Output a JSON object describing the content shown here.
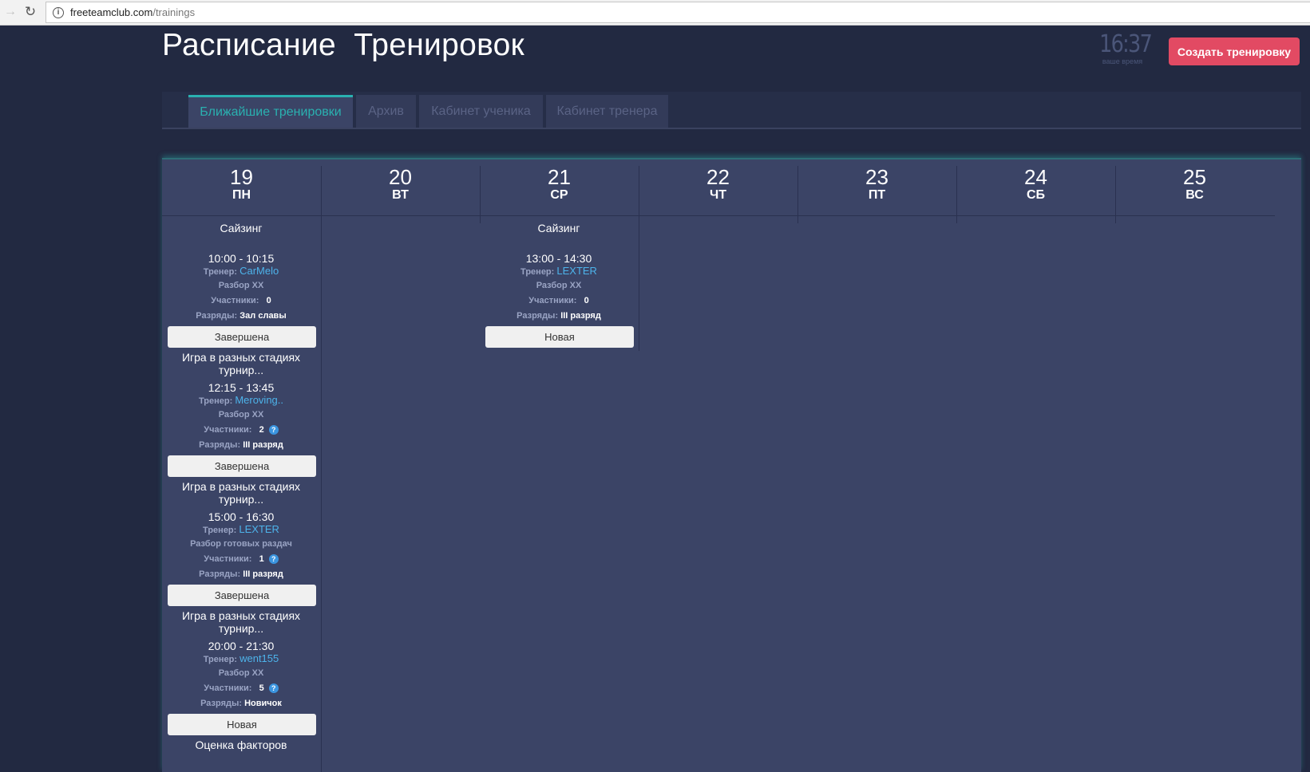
{
  "browser": {
    "url_domain": "freeteamclub.com",
    "url_path": "/trainings"
  },
  "header": {
    "title": "Расписание  Тренировок",
    "clock_time": "16:37",
    "clock_label": "ваше время",
    "create_button": "Создать тренировку"
  },
  "tabs": [
    {
      "label": "Ближайшие тренировки",
      "active": true
    },
    {
      "label": "Архив",
      "active": false
    },
    {
      "label": "Кабинет ученика",
      "active": false
    },
    {
      "label": "Кабинет тренера",
      "active": false
    }
  ],
  "labels": {
    "trainer": "Тренер:",
    "participants": "Участники:",
    "ranks": "Разряды:"
  },
  "days": [
    {
      "num": "19",
      "name": "ПН"
    },
    {
      "num": "20",
      "name": "ВТ"
    },
    {
      "num": "21",
      "name": "СР"
    },
    {
      "num": "22",
      "name": "ЧТ"
    },
    {
      "num": "23",
      "name": "ПТ"
    },
    {
      "num": "24",
      "name": "СБ"
    },
    {
      "num": "25",
      "name": "ВС"
    }
  ],
  "trainings": {
    "mon": [
      {
        "title": "Сайзинг",
        "time": "10:00 - 10:15",
        "trainer": "CarMelo",
        "topic": "Разбор XX",
        "participants": "0",
        "ranks": "Зал славы",
        "status": "Завершена"
      },
      {
        "title": "Игра в разных стадиях турнир...",
        "time": "12:15 - 13:45",
        "trainer": "Meroving..",
        "topic": "Разбор XX",
        "participants": "2",
        "ranks": "III разряд",
        "status": "Завершена"
      },
      {
        "title": "Игра в разных стадиях турнир...",
        "time": "15:00 - 16:30",
        "trainer": "LEXTER",
        "topic": "Разбор готовых раздач",
        "participants": "1",
        "ranks": "III разряд",
        "status": "Завершена"
      },
      {
        "title": "Игра в разных стадиях турнир...",
        "time": "20:00 - 21:30",
        "trainer": "went155",
        "topic": "Разбор XX",
        "participants": "5",
        "ranks": "Новичок",
        "status": "Новая"
      },
      {
        "title": "Оценка факторов"
      }
    ],
    "wed": [
      {
        "title": "Сайзинг",
        "time": "13:00 - 14:30",
        "trainer": "LEXTER",
        "topic": "Разбор XX",
        "participants": "0",
        "ranks": "III разряд",
        "status": "Новая"
      }
    ]
  },
  "colors": {
    "background": "#222941",
    "panel": "#3b4466",
    "accent": "#2ab1b0",
    "create_button": "#e24a63",
    "trainer_link": "#4db3ea"
  }
}
